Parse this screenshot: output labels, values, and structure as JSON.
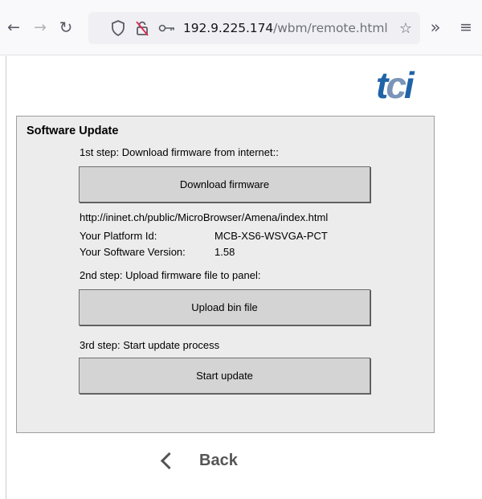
{
  "browser": {
    "url_host": "192.9.225.174",
    "url_path": "/wbm/remote.html"
  },
  "icons": {
    "back": "arrow-left-icon",
    "forward": "arrow-right-icon",
    "reload": "reload-icon",
    "shield": "shield-icon",
    "tracker": "tracking-blocked-icon",
    "key": "key-icon",
    "bookmark": "star-icon",
    "overflow": "double-chevron-icon",
    "menu": "hamburger-icon"
  },
  "logo": {
    "part1": "t",
    "part2": "c",
    "part3": "i"
  },
  "panel": {
    "title": "Software Update",
    "step1": "1st step: Download firmware from internet::",
    "download_button": "Download firmware",
    "firmware_url": "http://ininet.ch/public/MicroBrowser/Amena/index.html",
    "platform_label": "Your Platform Id:",
    "platform_value": "MCB-XS6-WSVGA-PCT",
    "version_label": "Your Software Version:",
    "version_value": "1.58",
    "step2": "2nd step: Upload firmware file to panel:",
    "upload_button": "Upload bin file",
    "step3": "3rd step: Start update process",
    "start_button": "Start update"
  },
  "footer": {
    "back_label": "Back"
  },
  "colors": {
    "panel_bg": "#ececec",
    "button_bg": "#d4d4d4",
    "logo_blue": "#1f63a8"
  }
}
